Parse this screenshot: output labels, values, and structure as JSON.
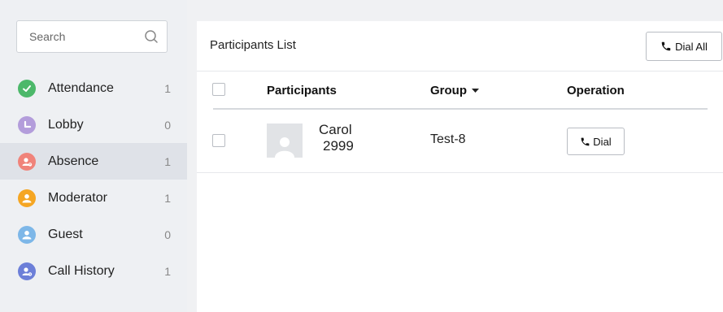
{
  "search": {
    "placeholder": "Search"
  },
  "menu": [
    {
      "label": "Attendance",
      "count": "1",
      "color": "#4cb86a",
      "icon": "check-circle-icon"
    },
    {
      "label": "Lobby",
      "count": "0",
      "color": "#b39ddb",
      "icon": "clock-icon"
    },
    {
      "label": "Absence",
      "count": "1",
      "color": "#f0837a",
      "icon": "absent-user-icon",
      "active": true
    },
    {
      "label": "Moderator",
      "count": "1",
      "color": "#f5a623",
      "icon": "moderator-user-icon"
    },
    {
      "label": "Guest",
      "count": "0",
      "color": "#7db7e8",
      "icon": "guest-user-icon"
    },
    {
      "label": "Call History",
      "count": "1",
      "color": "#6c7fd8",
      "icon": "call-history-icon"
    }
  ],
  "main": {
    "title": "Participants List",
    "dial_all_label": "Dial All",
    "columns": {
      "participants": "Participants",
      "group": "Group",
      "operation": "Operation"
    },
    "rows": [
      {
        "name": "Carol",
        "number": "2999",
        "group": "Test-8",
        "action": "Dial"
      }
    ]
  }
}
